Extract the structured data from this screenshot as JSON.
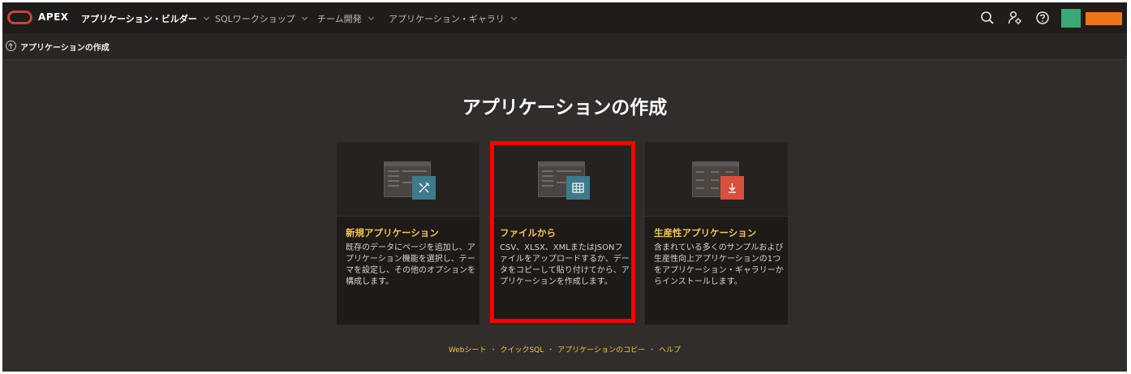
{
  "header": {
    "brand": "APEX",
    "nav": [
      {
        "label": "アプリケーション・ビルダー",
        "active": true
      },
      {
        "label": "SQLワークショップ",
        "active": false
      },
      {
        "label": "チーム開発",
        "active": false
      },
      {
        "label": "アプリケーション・ギャラリ",
        "active": false
      }
    ],
    "icons": [
      "search-icon",
      "user-settings-icon",
      "help-icon"
    ]
  },
  "breadcrumb": {
    "label": "アプリケーションの作成"
  },
  "page": {
    "title": "アプリケーションの作成"
  },
  "cards": [
    {
      "title": "新規アプリケーション",
      "description": "既存のデータにページを追加し、アプリケーション機能を選択し、テーマを設定し、その他のオプションを構成します。",
      "icon": "wand-icon",
      "color": "#3d7a8c"
    },
    {
      "title": "ファイルから",
      "description": "CSV、XLSX、XMLまたはJSONファイルをアップロードするか、データをコピーして貼り付けてから、アプリケーションを作成します。",
      "icon": "table-icon",
      "color": "#3d7a8c"
    },
    {
      "title": "生産性アプリケーション",
      "description": "含まれている多くのサンプルおよび生産性向上アプリケーションの1つをアプリケーション・ギャラリーからインストールします。",
      "icon": "download-icon",
      "color": "#d94f3d"
    }
  ],
  "footer": {
    "links": [
      "Webシート",
      "クイックSQL",
      "アプリケーションのコピー",
      "ヘルプ"
    ],
    "separator": "・"
  },
  "colors": {
    "accent": "#f7c34a",
    "logo": "#c74634",
    "highlight": "#ff0000"
  }
}
